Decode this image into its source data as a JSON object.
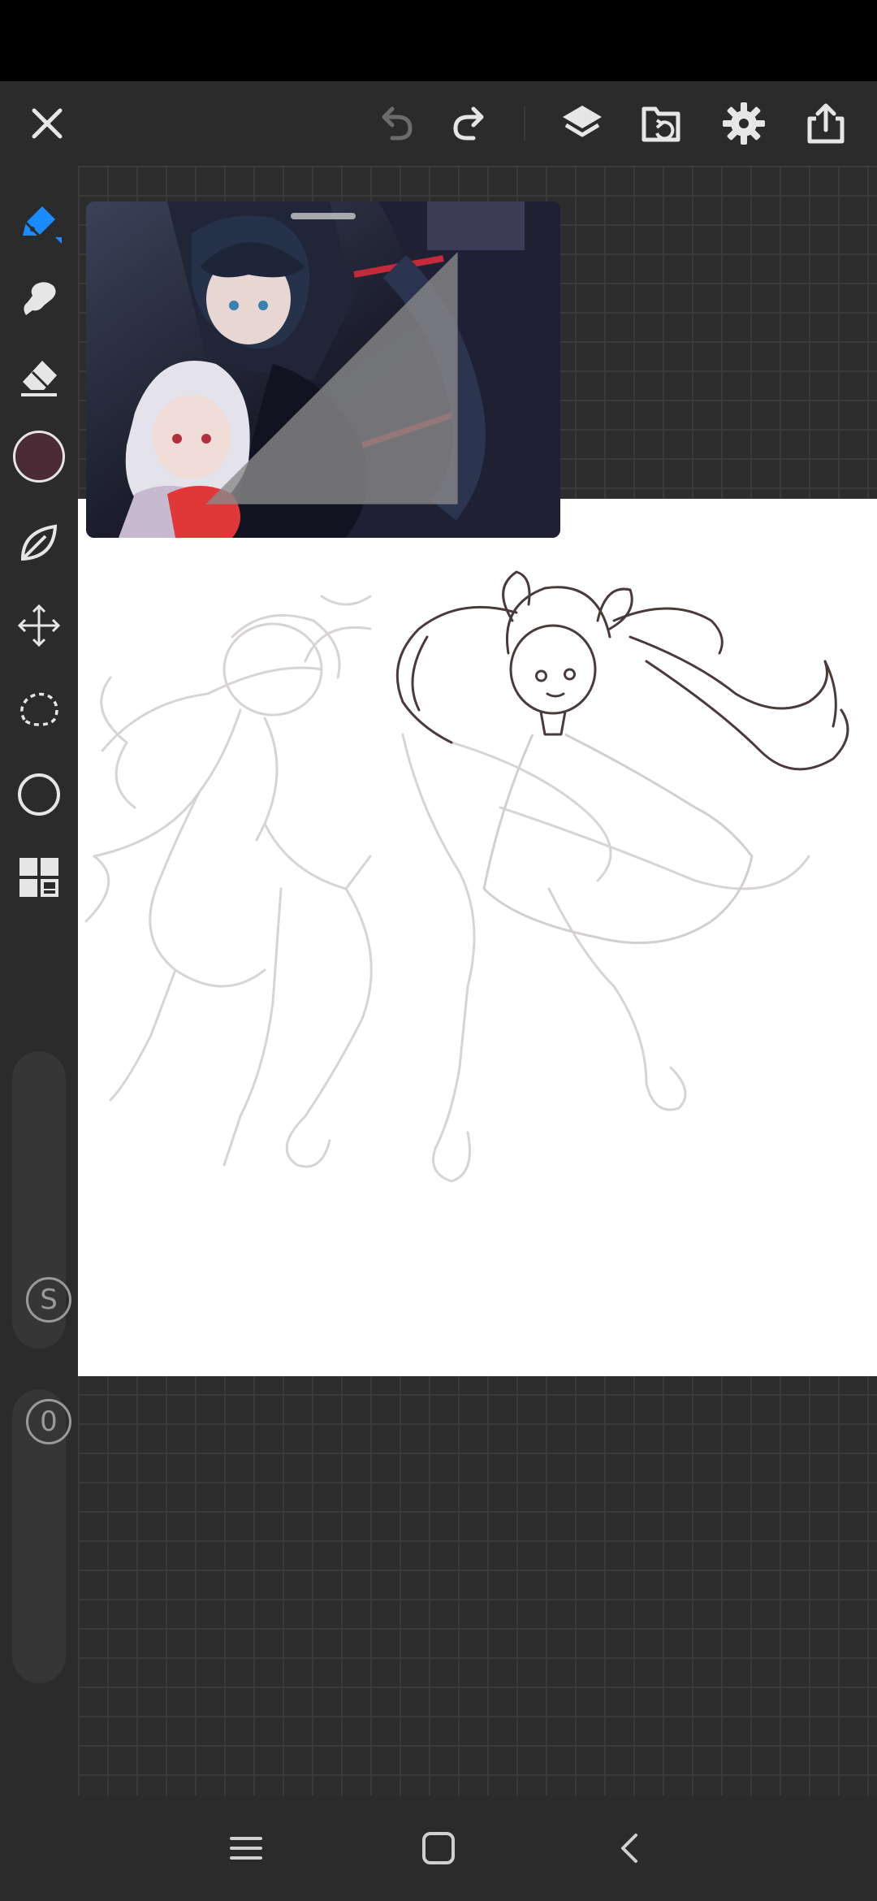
{
  "app": {
    "accent_color": "#1a8cff",
    "current_color": "#4b2b35"
  },
  "toolbar": {
    "buttons": [
      {
        "name": "close-icon"
      },
      {
        "name": "undo-icon",
        "enabled": false
      },
      {
        "name": "redo-icon",
        "enabled": true
      },
      {
        "name": "layers-icon"
      },
      {
        "name": "gallery-import-icon"
      },
      {
        "name": "settings-gear-icon"
      },
      {
        "name": "share-export-icon"
      }
    ]
  },
  "tools": [
    {
      "name": "brush-pen-icon",
      "active": true
    },
    {
      "name": "smudge-icon"
    },
    {
      "name": "eraser-icon"
    },
    {
      "name": "color-picker-swatch"
    },
    {
      "name": "leaf-brush-icon"
    },
    {
      "name": "move-transform-icon"
    },
    {
      "name": "lasso-select-icon"
    },
    {
      "name": "circle-shape-icon"
    },
    {
      "name": "grid-panels-icon"
    }
  ],
  "sliders": {
    "size_label": "S",
    "opacity_label": "0"
  },
  "reference_window": {
    "content": "reference image"
  },
  "nav": {
    "buttons": [
      "recent-apps-icon",
      "home-icon",
      "back-icon"
    ]
  }
}
